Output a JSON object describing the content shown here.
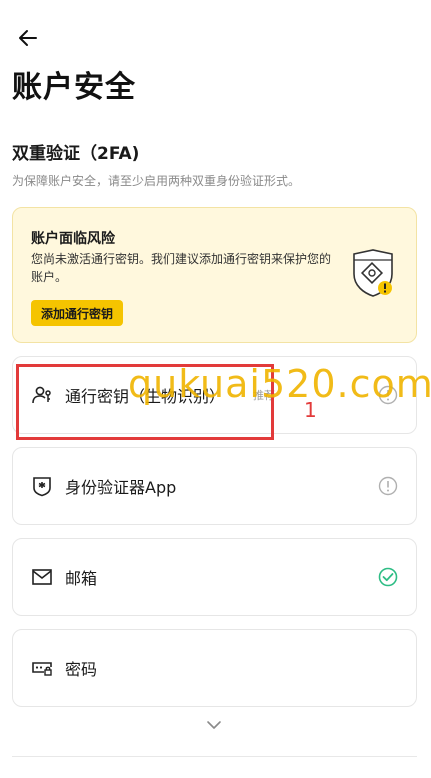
{
  "header": {
    "title": "账户安全"
  },
  "section": {
    "title": "双重验证（2FA)",
    "description": "为保障账户安全，请至少启用两种双重身份验证形式。"
  },
  "risk_card": {
    "title": "账户面临风险",
    "description": "您尚未激活通行密钥。我们建议添加通行密钥来保护您的账户。",
    "button_label": "添加通行密钥"
  },
  "items": [
    {
      "label": "通行密钥（生物识别）",
      "extra": "推荐",
      "status": "warning"
    },
    {
      "label": "身份验证器App",
      "status": "warning"
    },
    {
      "label": "邮箱",
      "status": "done"
    },
    {
      "label": "密码",
      "status": "none"
    }
  ],
  "overlay": {
    "watermark": "qukuai520.com",
    "marker": "1"
  },
  "colors": {
    "accent": "#f5c400",
    "success": "#2ebd85",
    "warning_icon": "#b0b0b0",
    "annotation": "#e23a3a"
  }
}
